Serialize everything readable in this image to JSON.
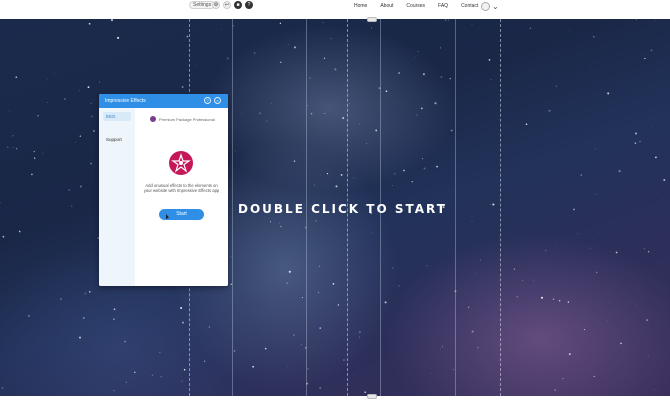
{
  "topbar": {
    "settings_label": "Settings",
    "tools": [
      "⚙",
      "↩",
      "■",
      "?"
    ]
  },
  "nav": {
    "items": [
      "Home",
      "About",
      "Courses",
      "FAQ",
      "Contact"
    ]
  },
  "hero": {
    "headline": "DOUBLE CLICK TO START"
  },
  "panel": {
    "title": "Impressive Effects",
    "help_icon": "?",
    "close_icon": "×",
    "sidebar": {
      "items": [
        {
          "label": "EEG",
          "active": true
        },
        {
          "label": "Support",
          "active": false
        }
      ]
    },
    "package_label": "Premium Package Professional",
    "description": "Add unusual effects to the elements on your website with Impressive Effects app",
    "start_label": "Start"
  },
  "colors": {
    "accent": "#2f8fe6",
    "logo": "#c4185a",
    "package_icon": "#7a3c8c"
  }
}
